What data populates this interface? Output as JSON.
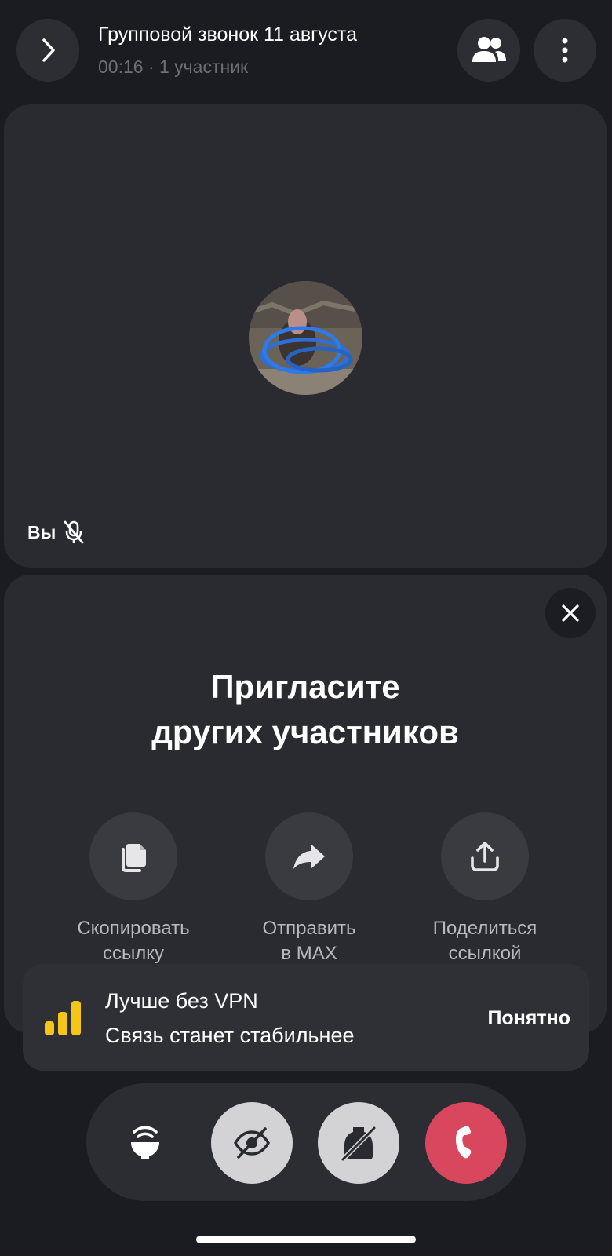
{
  "header": {
    "title": "Групповой звонок 11 августа",
    "subtitle": "00:16 · 1 участник",
    "back_icon": "chevron-right-icon",
    "participants_icon": "people-icon",
    "menu_icon": "more-vertical-icon"
  },
  "tile": {
    "you_label": "Вы",
    "mic_state_icon": "mic-off-icon",
    "avatar_description": "hippo-avatar"
  },
  "invite": {
    "title_line1": "Пригласите",
    "title_line2": "других участников",
    "close_icon": "close-icon",
    "actions": [
      {
        "icon": "copy-icon",
        "line1": "Скопировать",
        "line2": "ссылку"
      },
      {
        "icon": "forward-icon",
        "line1": "Отправить",
        "line2": "в MAX"
      },
      {
        "icon": "share-icon",
        "line1": "Поделиться",
        "line2": "ссылкой"
      }
    ]
  },
  "toast": {
    "title": "Лучше без VPN",
    "message": "Связь станет стабильнее",
    "button": "Понятно",
    "icon": "signal-bars-icon",
    "icon_color": "#f5c518"
  },
  "controls": [
    {
      "name": "speaker-button",
      "icon": "speaker-icon"
    },
    {
      "name": "camera-off-button",
      "icon": "camera-off-icon"
    },
    {
      "name": "mic-off-button",
      "icon": "mic-off-icon"
    },
    {
      "name": "end-call-button",
      "icon": "hang-up-icon",
      "color": "#d9475f"
    }
  ],
  "colors": {
    "background": "#1b1c21",
    "surface": "#2a2b31",
    "end_call": "#d9475f",
    "control_active": "#d3d3d6"
  }
}
